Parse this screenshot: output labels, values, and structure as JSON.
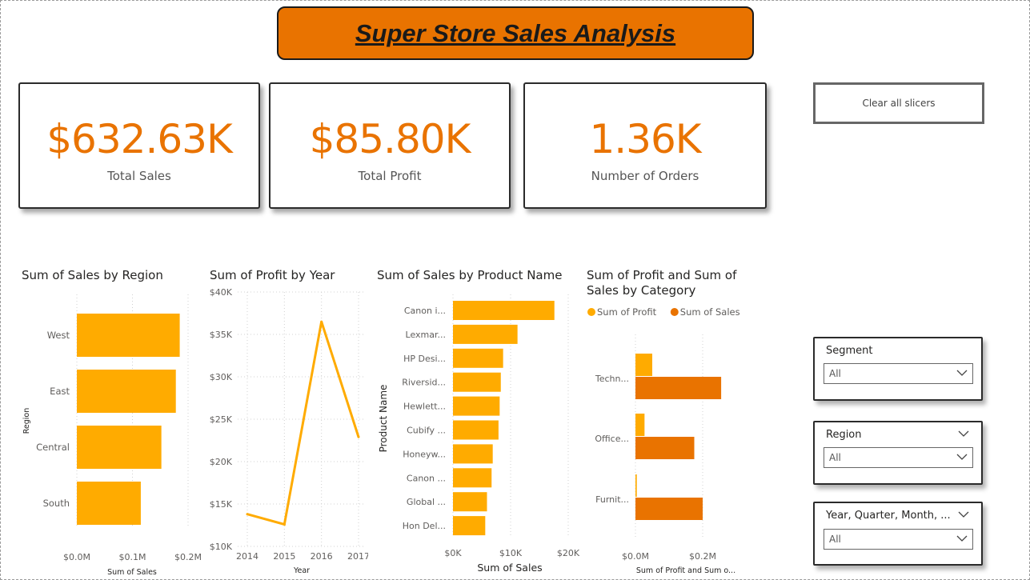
{
  "header": {
    "title": "Super Store Sales Analysis"
  },
  "kpis": [
    {
      "value": "$632.63K",
      "label": "Total Sales"
    },
    {
      "value": "$85.80K",
      "label": "Total Profit"
    },
    {
      "value": "1.36K",
      "label": "Number of Orders"
    }
  ],
  "clear_button": {
    "label": "Clear all slicers"
  },
  "slicers": [
    {
      "title": "Segment",
      "value": "All"
    },
    {
      "title": "Region",
      "value": "All"
    },
    {
      "title": "Year, Quarter, Month, ...",
      "value": "All"
    }
  ],
  "colors": {
    "accent": "#E97300",
    "bar": "#FFAB00",
    "bar_dark": "#E97300"
  },
  "chart_data": [
    {
      "type": "bar",
      "orientation": "horizontal",
      "title": "Sum of Sales by Region",
      "categories": [
        "West",
        "East",
        "Central",
        "South"
      ],
      "values": [
        0.185,
        0.178,
        0.152,
        0.115
      ],
      "xlabel": "Sum of Sales",
      "ylabel": "Region",
      "xticks": [
        "$0.0M",
        "$0.1M",
        "$0.2M"
      ],
      "xlim": [
        0,
        0.2
      ],
      "grid": true
    },
    {
      "type": "line",
      "title": "Sum of Profit by Year",
      "x": [
        "2014",
        "2015",
        "2016",
        "2017"
      ],
      "values": [
        13800,
        12600,
        36500,
        22900
      ],
      "xlabel": "Year",
      "ylabel": "",
      "yticks": [
        "$40K",
        "$35K",
        "$30K",
        "$25K",
        "$20K",
        "$15K",
        "$10K"
      ],
      "ylim": [
        10000,
        40000
      ],
      "grid": true
    },
    {
      "type": "bar",
      "orientation": "horizontal",
      "title": "Sum of Sales by Product Name",
      "categories": [
        "Canon i...",
        "Lexmar...",
        "HP Desi...",
        "Riversid...",
        "Hewlett...",
        "Cubify ...",
        "Honeyw...",
        "Canon ...",
        "Global ...",
        "Hon Del..."
      ],
      "values": [
        17600,
        11200,
        8700,
        8300,
        8100,
        7900,
        6900,
        6700,
        5900,
        5600
      ],
      "xlabel": "Sum of Sales",
      "ylabel": "Product Name",
      "xticks": [
        "$0K",
        "$10K",
        "$20K"
      ],
      "xlim": [
        0,
        20000
      ],
      "grid": true
    },
    {
      "type": "bar",
      "orientation": "horizontal",
      "title": "Sum of Profit and Sum of Sales by Category",
      "categories": [
        "Techn...",
        "Office...",
        "Furnit..."
      ],
      "series": [
        {
          "name": "Sum of Profit",
          "values": [
            0.05,
            0.027,
            0.004
          ]
        },
        {
          "name": "Sum of Sales",
          "values": [
            0.255,
            0.175,
            0.2
          ]
        }
      ],
      "xlabel": "Sum of Profit and Sum o...",
      "xticks": [
        "$0.0M",
        "$0.2M"
      ],
      "xlim": [
        0,
        0.2
      ],
      "legend": "top-left",
      "grid": true
    }
  ]
}
